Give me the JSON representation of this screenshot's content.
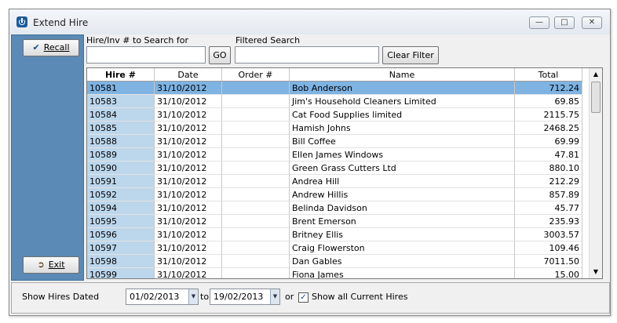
{
  "window": {
    "title": "Extend Hire"
  },
  "sidebar": {
    "recall_label": "Recall",
    "exit_label": "Exit"
  },
  "search": {
    "hire_label": "Hire/Inv # to Search for",
    "hire_value": "",
    "go_label": "GO",
    "filtered_label": "Filtered Search",
    "filtered_value": "",
    "clear_label": "Clear Filter"
  },
  "table": {
    "columns": [
      "Hire #",
      "Date",
      "Order #",
      "Name",
      "Total"
    ],
    "rows": [
      {
        "hire": "10581",
        "date": "31/10/2012",
        "order": "",
        "name": "Bob Anderson",
        "total": "712.24"
      },
      {
        "hire": "10583",
        "date": "31/10/2012",
        "order": "",
        "name": "Jim's Household Cleaners Limited",
        "total": "69.85"
      },
      {
        "hire": "10584",
        "date": "31/10/2012",
        "order": "",
        "name": "Cat Food Supplies limited",
        "total": "2115.75"
      },
      {
        "hire": "10585",
        "date": "31/10/2012",
        "order": "",
        "name": "Hamish Johns",
        "total": "2468.25"
      },
      {
        "hire": "10588",
        "date": "31/10/2012",
        "order": "",
        "name": "Bill Coffee",
        "total": "69.99"
      },
      {
        "hire": "10589",
        "date": "31/10/2012",
        "order": "",
        "name": "Ellen James Windows",
        "total": "47.81"
      },
      {
        "hire": "10590",
        "date": "31/10/2012",
        "order": "",
        "name": "Green Grass Cutters Ltd",
        "total": "880.10"
      },
      {
        "hire": "10591",
        "date": "31/10/2012",
        "order": "",
        "name": "Andrea Hill",
        "total": "212.29"
      },
      {
        "hire": "10592",
        "date": "31/10/2012",
        "order": "",
        "name": "Andrew Hillis",
        "total": "857.89"
      },
      {
        "hire": "10594",
        "date": "31/10/2012",
        "order": "",
        "name": "Belinda Davidson",
        "total": "45.77"
      },
      {
        "hire": "10595",
        "date": "31/10/2012",
        "order": "",
        "name": "Brent Emerson",
        "total": "235.93"
      },
      {
        "hire": "10596",
        "date": "31/10/2012",
        "order": "",
        "name": "Britney Ellis",
        "total": "3003.57"
      },
      {
        "hire": "10597",
        "date": "31/10/2012",
        "order": "",
        "name": "Craig Flowerston",
        "total": "109.46"
      },
      {
        "hire": "10598",
        "date": "31/10/2012",
        "order": "",
        "name": "Dan Gables",
        "total": "7011.50"
      },
      {
        "hire": "10599",
        "date": "31/10/2012",
        "order": "",
        "name": "Fiona James",
        "total": "15.00"
      }
    ]
  },
  "bottom": {
    "show_label": "Show Hires Dated",
    "from_date": "01/02/2013",
    "to_label": "to",
    "to_date": "19/02/2013",
    "or_label": "or",
    "current_label": "Show all Current Hires",
    "current_checked": true
  },
  "colors": {
    "sidebar": "#5a8ab5",
    "selected_row": "#7eb3e2",
    "hire_column": "#bcd7ec"
  }
}
